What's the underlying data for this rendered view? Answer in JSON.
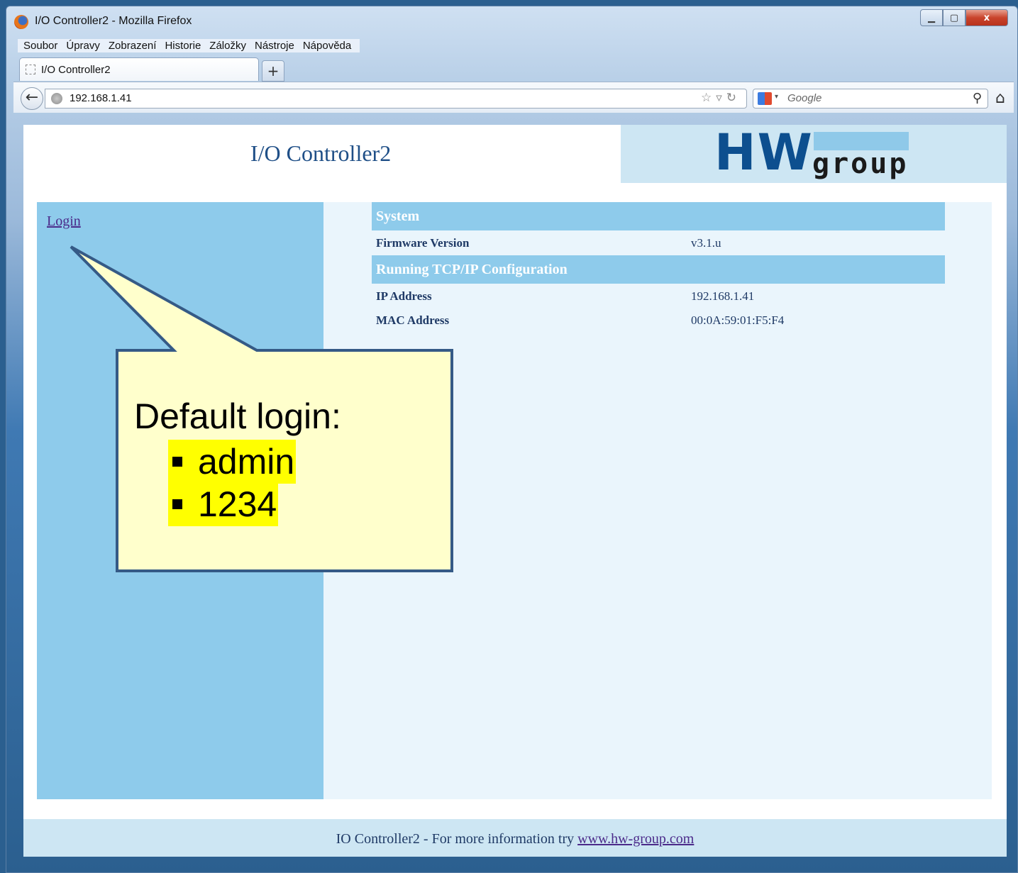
{
  "browser": {
    "window_title": "I/O Controller2 - Mozilla Firefox",
    "window_controls": {
      "close": "x"
    },
    "menu": [
      "Soubor",
      "Úpravy",
      "Zobrazení",
      "Historie",
      "Záložky",
      "Nástroje",
      "Nápověda"
    ],
    "tab_label": "I/O Controller2",
    "new_tab_label": "+",
    "url": "192.168.1.41",
    "search_placeholder": "Google",
    "icons": [
      "firefox-logo",
      "back-arrow",
      "globe",
      "bookmark-star",
      "dropdown-arrow",
      "reload",
      "google-logo",
      "search-magnifier",
      "home"
    ]
  },
  "page": {
    "title": "I/O Controller2",
    "logo": {
      "main": "HW",
      "sub": "group"
    },
    "sidebar": {
      "login_link": "Login"
    },
    "sections": [
      {
        "header": "System",
        "rows": [
          {
            "label": "Firmware Version",
            "value": "v3.1.u"
          }
        ]
      },
      {
        "header": "Running TCP/IP Configuration",
        "rows": [
          {
            "label": "IP Address",
            "value": "192.168.1.41"
          },
          {
            "label": "MAC Address",
            "value": "00:0A:59:01:F5:F4"
          }
        ]
      }
    ],
    "footer": {
      "text": "IO Controller2 - For more information try ",
      "link": "www.hw-group.com"
    }
  },
  "callout": {
    "title": "Default login:",
    "items": [
      "admin",
      "1234"
    ],
    "colors": {
      "fill": "#ffffcc",
      "border": "#355a86",
      "highlight": "#ffff00"
    }
  }
}
